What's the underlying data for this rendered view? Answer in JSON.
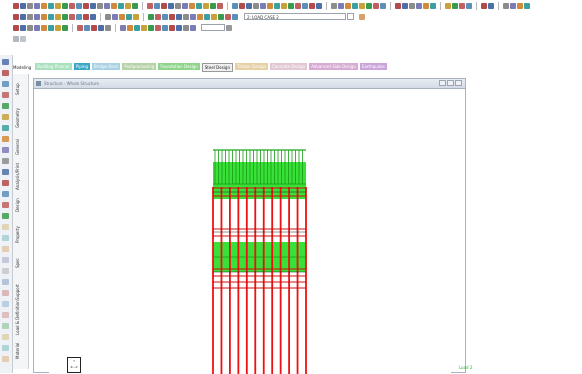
{
  "toolbar": {
    "load_case_combo": "2: LOAD CASE 2"
  },
  "mode_strip": {
    "label": "Modeling",
    "tabs": [
      {
        "label": "Building Planner",
        "color": "#a9e0bd"
      },
      {
        "label": "Piping",
        "color": "#38a6c5"
      },
      {
        "label": "Bridge Deck",
        "color": "#a8d1e4"
      },
      {
        "label": "Postprocessing",
        "color": "#b6d2a9"
      },
      {
        "label": "Foundation Design",
        "color": "#8fd48b"
      },
      {
        "label": "Steel Design",
        "color": "#f0f0f0"
      },
      {
        "label": "Timber Design",
        "color": "#e5d1a3"
      },
      {
        "label": "Concrete Design",
        "color": "#e2c7d5"
      },
      {
        "label": "Advanced Slab Design",
        "color": "#d7aad3"
      },
      {
        "label": "Earthquake",
        "color": "#c8a4db"
      }
    ]
  },
  "side_tabs": [
    "Setup",
    "Geometry",
    "General",
    "Analysis/Print",
    "Design",
    "Property",
    "Spec",
    "Support",
    "Load & Definition",
    "Material"
  ],
  "document": {
    "title": "Structure - Whole Structure",
    "axis_label": "Y\nZ—X",
    "load_label": "Load 2"
  }
}
